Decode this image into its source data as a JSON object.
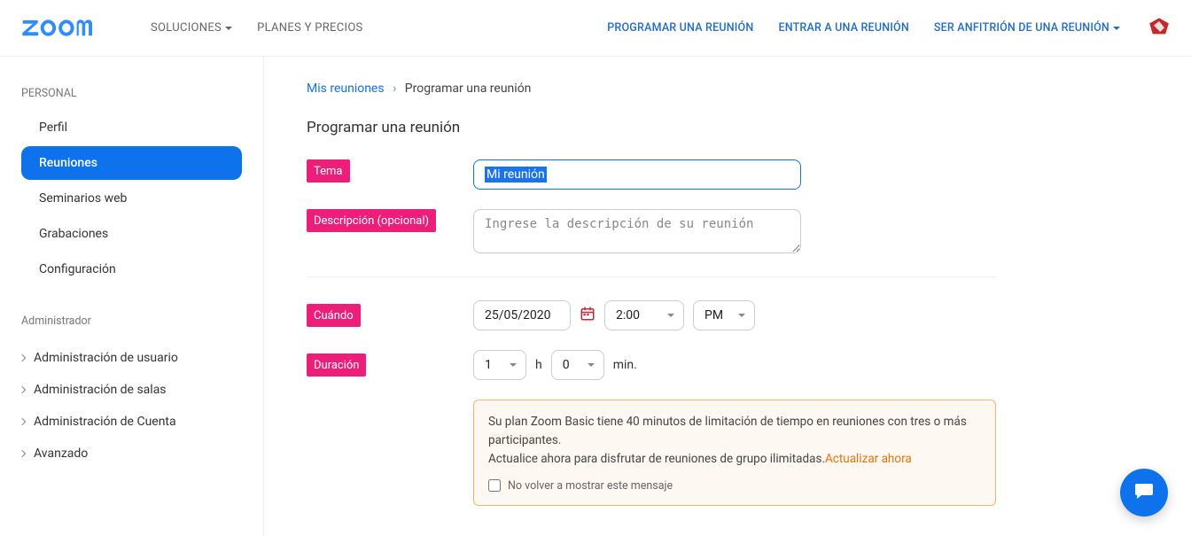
{
  "header": {
    "logo_text": "zoom",
    "nav_left": [
      {
        "label": "SOLUCIONES",
        "has_caret": true
      },
      {
        "label": "PLANES Y PRECIOS",
        "has_caret": false
      }
    ],
    "nav_right": [
      {
        "label": "PROGRAMAR UNA REUNIÓN",
        "has_caret": false
      },
      {
        "label": "ENTRAR A UNA REUNIÓN",
        "has_caret": false
      },
      {
        "label": "SER ANFITRIÓN DE UNA REUNIÓN",
        "has_caret": true
      }
    ]
  },
  "sidebar": {
    "personal_heading": "PERSONAL",
    "personal_items": [
      {
        "label": "Perfil",
        "active": false
      },
      {
        "label": "Reuniones",
        "active": true
      },
      {
        "label": "Seminarios web",
        "active": false
      },
      {
        "label": "Grabaciones",
        "active": false
      },
      {
        "label": "Configuración",
        "active": false
      }
    ],
    "admin_heading": "Administrador",
    "admin_items": [
      {
        "label": "Administración de usuario"
      },
      {
        "label": "Administración de salas"
      },
      {
        "label": "Administración de Cuenta"
      },
      {
        "label": "Avanzado"
      }
    ]
  },
  "breadcrumb": {
    "root": "Mis reuniones",
    "current": "Programar una reunión"
  },
  "page": {
    "title": "Programar una reunión"
  },
  "form": {
    "topic": {
      "label": "Tema",
      "value": "Mi reunión"
    },
    "description": {
      "label": "Descripción (opcional)",
      "placeholder": "Ingrese la descripción de su reunión"
    },
    "when": {
      "label": "Cuándo",
      "date": "25/05/2020",
      "time": "2:00",
      "meridiem": "PM"
    },
    "duration": {
      "label": "Duración",
      "hours": "1",
      "hours_unit": "h",
      "minutes": "0",
      "minutes_unit": "min."
    },
    "notice": {
      "line1": "Su plan Zoom Basic tiene 40 minutos de limitación de tiempo en reuniones con tres o más participantes.",
      "line2_prefix": "Actualice ahora para disfrutar de reuniones de grupo ilimitadas.",
      "upgrade_link": "Actualizar ahora",
      "dont_show": "No volver a mostrar este mensaje"
    }
  }
}
